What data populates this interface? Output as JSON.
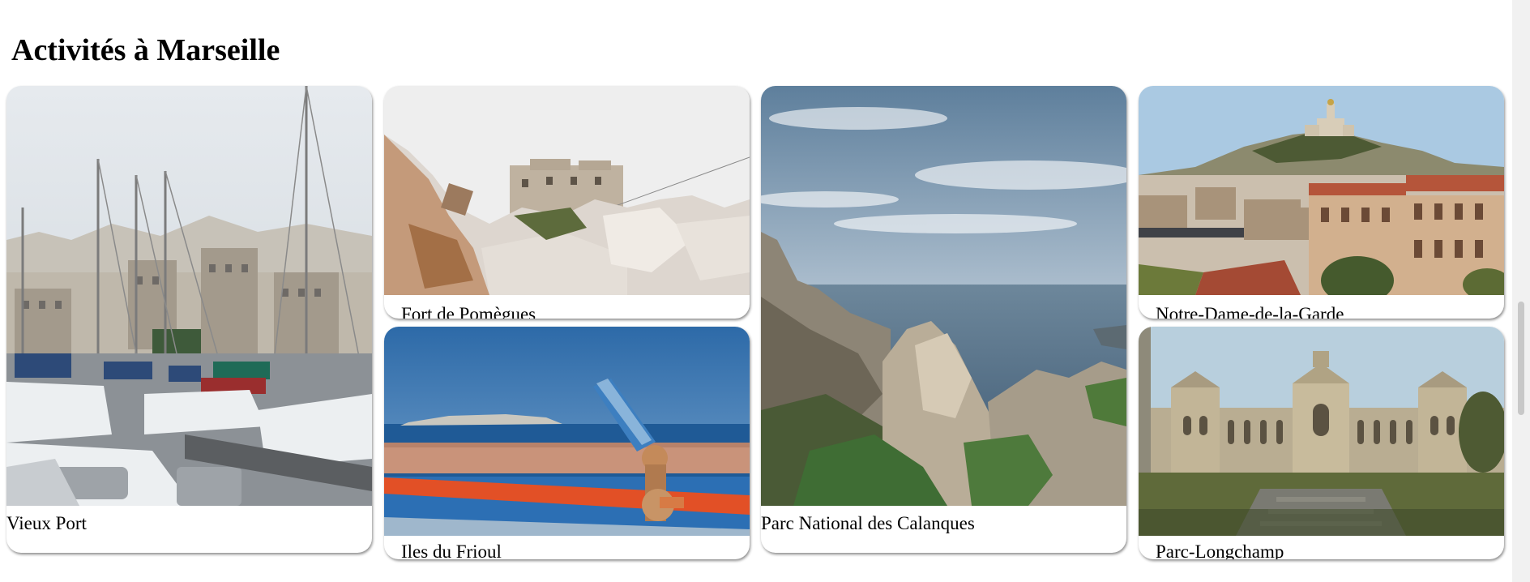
{
  "page": {
    "title": "Activités à Marseille"
  },
  "cards": {
    "vieux_port": {
      "label": "Vieux Port"
    },
    "fort_pomegues": {
      "label": "Fort de Pomègues"
    },
    "calanques": {
      "label": "Parc National des Calanques"
    },
    "notre_dame": {
      "label": "Notre-Dame-de-la-Garde"
    },
    "frioul": {
      "label": "Iles du Frioul"
    },
    "longchamp": {
      "label": "Parc-Longchamp"
    }
  },
  "colors": {
    "card_shadow": "#555555",
    "scrollbar_track": "#f1f1f1",
    "scrollbar_thumb": "#c8c8c8"
  }
}
